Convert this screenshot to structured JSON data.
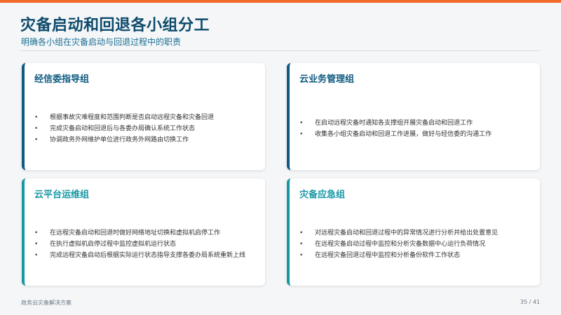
{
  "colors": {
    "accent_bar": "#f26b2a",
    "title": "#0d4a6b",
    "card_dark_border": "#0e5a80",
    "card_teal_border": "#1798a6"
  },
  "page": {
    "title": "灾备启动和回退各小组分工",
    "subtitle": "明确各小组在灾备启动与回退过程中的职责"
  },
  "cards": [
    {
      "title": "经信委指导组",
      "items": [
        "根据事故灾难程度和范围判断是否启动远程灾备和灾备回退",
        "完成灾备启动和回退后与各委办局确认系统工作状态",
        "协调政务外网维护单位进行政务外网路由切换工作"
      ]
    },
    {
      "title": "云业务管理组",
      "items": [
        "在启动远程灾备时通知各支撑组开展灾备启动和回退工作",
        "收集各小组灾备启动和回退工作进展，做好与经信委的沟通工作"
      ]
    },
    {
      "title": "云平台运维组",
      "items": [
        "在远程灾备启动和回退时做好网络地址切换和虚拟机启停工作",
        "在执行虚拟机启停过程中监控虚拟机运行状态",
        "完成远程灾备启动后根据实际运行状态指导支撑各委办局系统重新上线"
      ]
    },
    {
      "title": "灾备应急组",
      "items": [
        "对远程灾备启动和回退过程中的异常情况进行分析并给出处置意见",
        "在远程灾备启动过程中监控和分析灾备数据中心运行负荷情况",
        "在远程灾备回退过程中监控和分析备份软件工作状态"
      ]
    }
  ],
  "bullet_symbol": "•",
  "footer": {
    "left": "政务云灾备解决方案",
    "right": "35 / 41"
  }
}
